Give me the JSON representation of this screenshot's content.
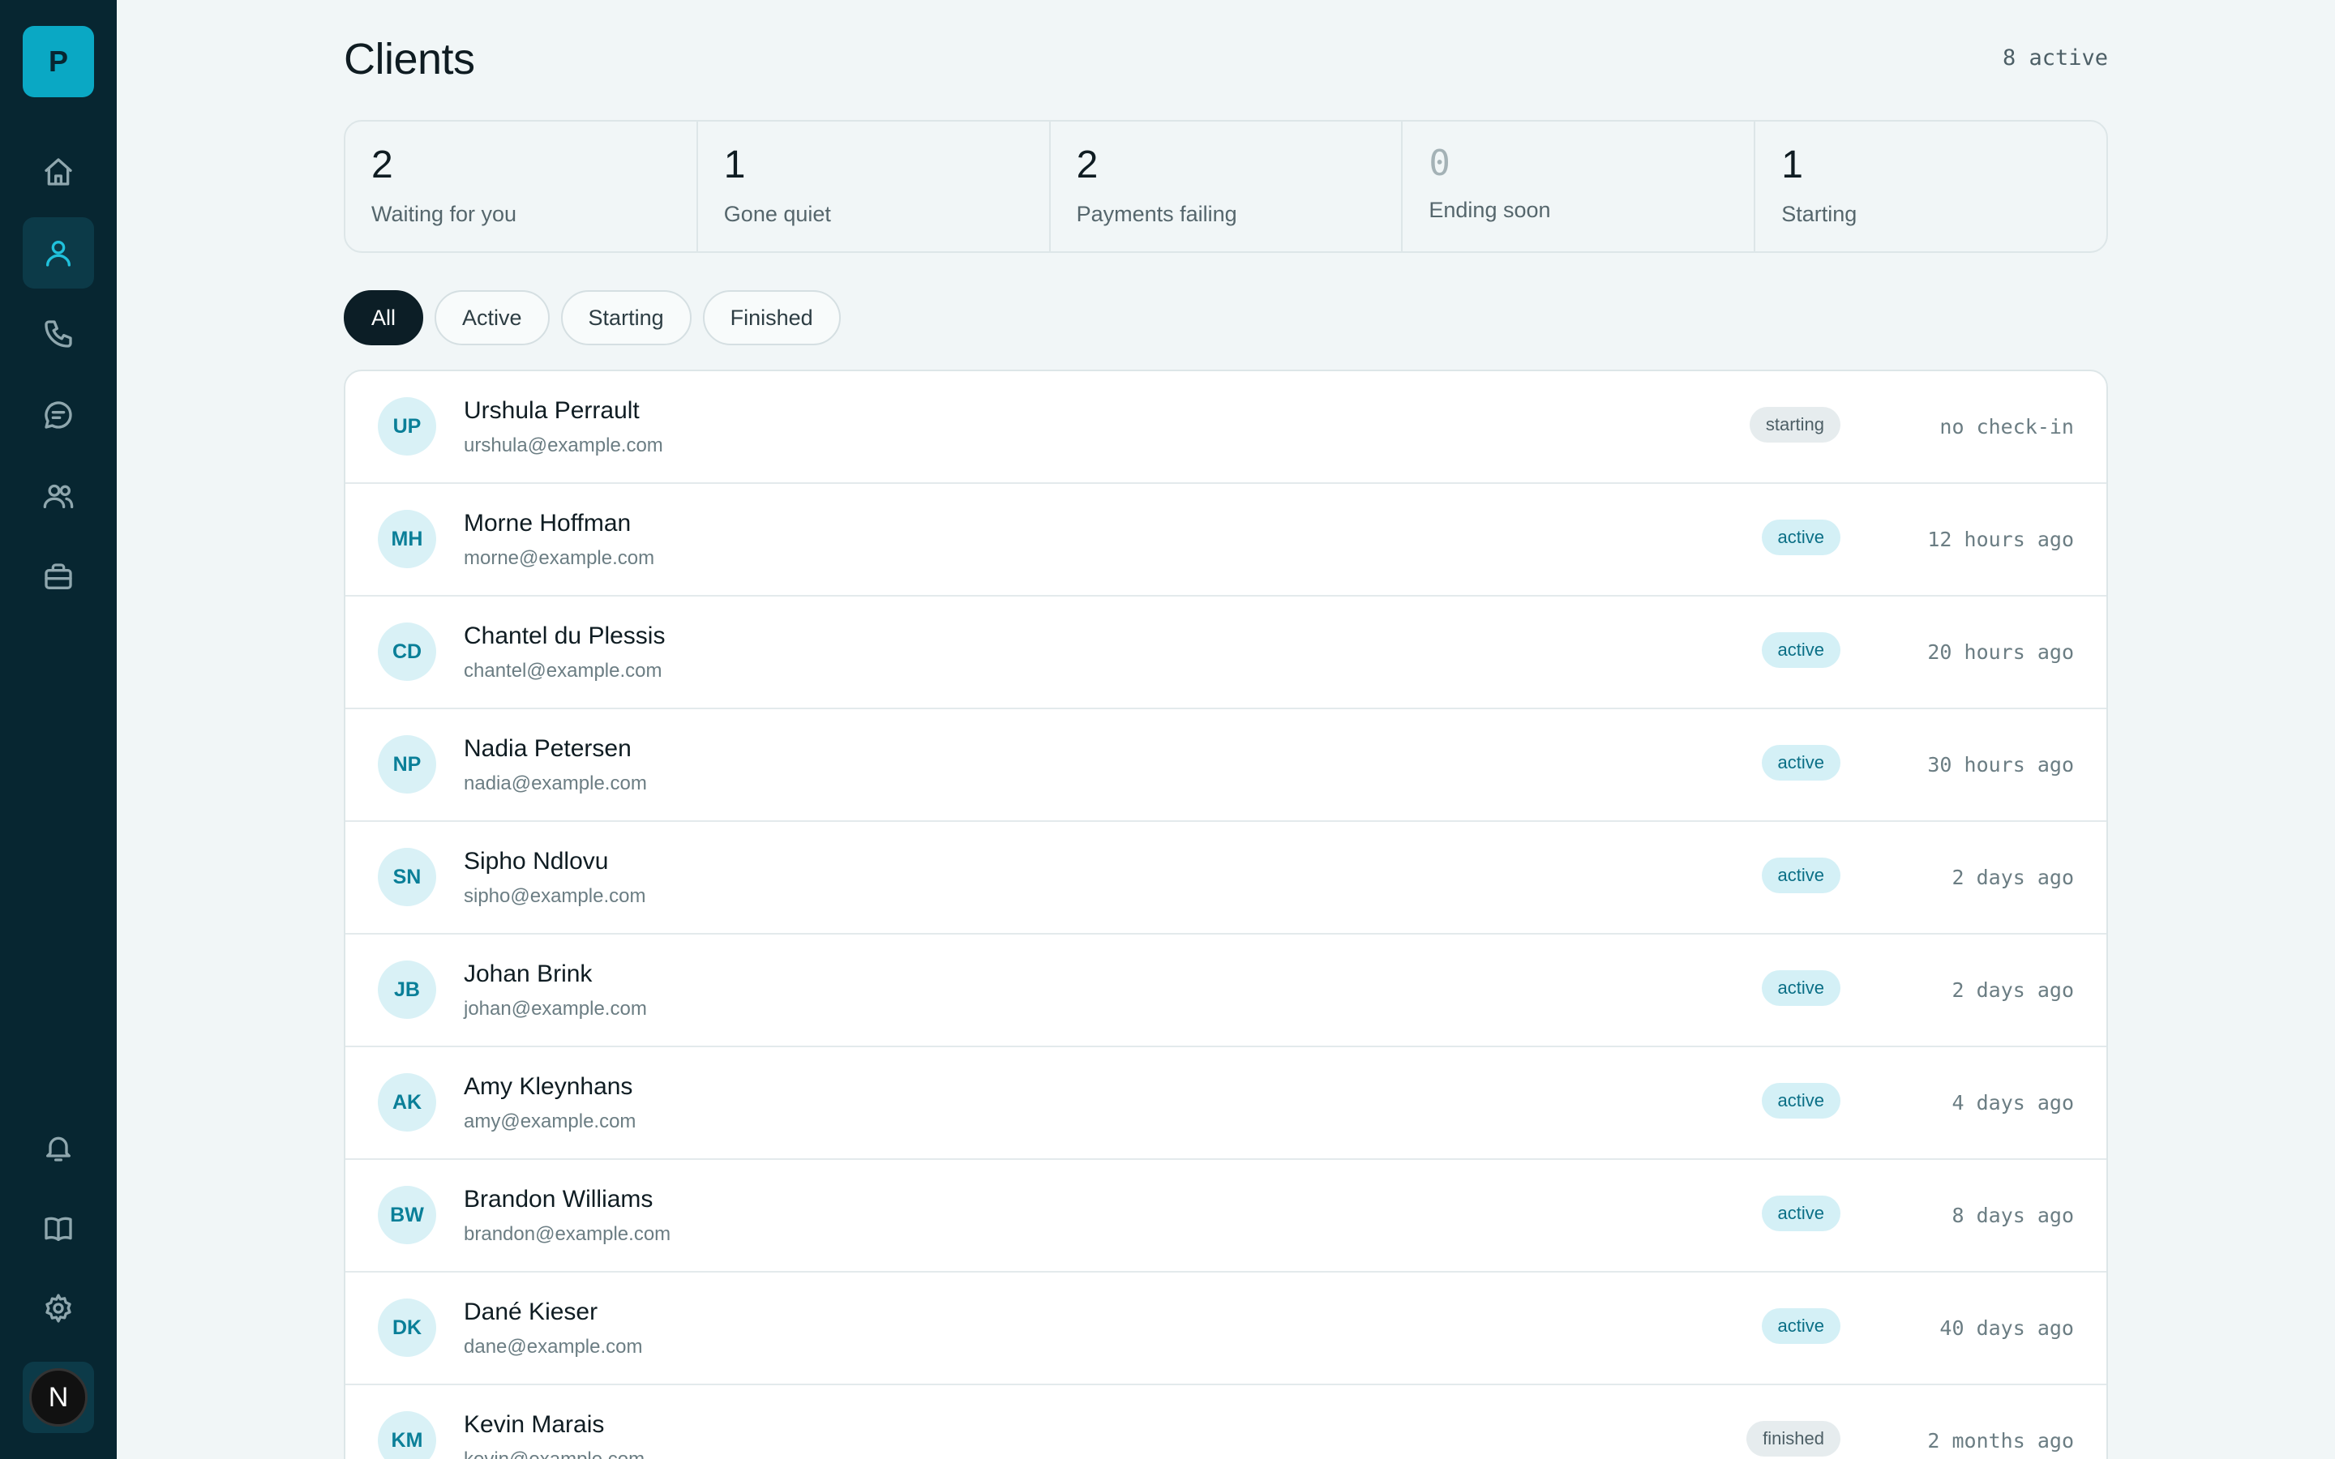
{
  "app": {
    "logo_letter": "P",
    "user_initial": "N"
  },
  "sidebar": {
    "items": [
      {
        "name": "home-icon"
      },
      {
        "name": "user-icon",
        "active": true
      },
      {
        "name": "phone-icon"
      },
      {
        "name": "chat-icon"
      },
      {
        "name": "users-icon"
      },
      {
        "name": "briefcase-icon"
      }
    ],
    "bottom": [
      {
        "name": "bell-icon"
      },
      {
        "name": "book-icon"
      },
      {
        "name": "gear-icon"
      }
    ]
  },
  "header": {
    "title": "Clients",
    "active_count": "8 active"
  },
  "stats": [
    {
      "value": "2",
      "label": "Waiting for you"
    },
    {
      "value": "1",
      "label": "Gone quiet"
    },
    {
      "value": "2",
      "label": "Payments failing"
    },
    {
      "value": "0",
      "label": "Ending soon"
    },
    {
      "value": "1",
      "label": "Starting"
    }
  ],
  "filters": [
    "All",
    "Active",
    "Starting",
    "Finished"
  ],
  "clients": [
    {
      "initials": "UP",
      "name": "Urshula Perrault",
      "email": "urshula@example.com",
      "status": "starting",
      "last": "no check-in"
    },
    {
      "initials": "MH",
      "name": "Morne Hoffman",
      "email": "morne@example.com",
      "status": "active",
      "last": "12 hours ago"
    },
    {
      "initials": "CD",
      "name": "Chantel du Plessis",
      "email": "chantel@example.com",
      "status": "active",
      "last": "20 hours ago"
    },
    {
      "initials": "NP",
      "name": "Nadia Petersen",
      "email": "nadia@example.com",
      "status": "active",
      "last": "30 hours ago"
    },
    {
      "initials": "SN",
      "name": "Sipho Ndlovu",
      "email": "sipho@example.com",
      "status": "active",
      "last": "2 days ago"
    },
    {
      "initials": "JB",
      "name": "Johan Brink",
      "email": "johan@example.com",
      "status": "active",
      "last": "2 days ago"
    },
    {
      "initials": "AK",
      "name": "Amy Kleynhans",
      "email": "amy@example.com",
      "status": "active",
      "last": "4 days ago"
    },
    {
      "initials": "BW",
      "name": "Brandon Williams",
      "email": "brandon@example.com",
      "status": "active",
      "last": "8 days ago"
    },
    {
      "initials": "DK",
      "name": "Dané Kieser",
      "email": "dane@example.com",
      "status": "active",
      "last": "40 days ago"
    },
    {
      "initials": "KM",
      "name": "Kevin Marais",
      "email": "kevin@example.com",
      "status": "finished",
      "last": "2 months ago"
    }
  ]
}
